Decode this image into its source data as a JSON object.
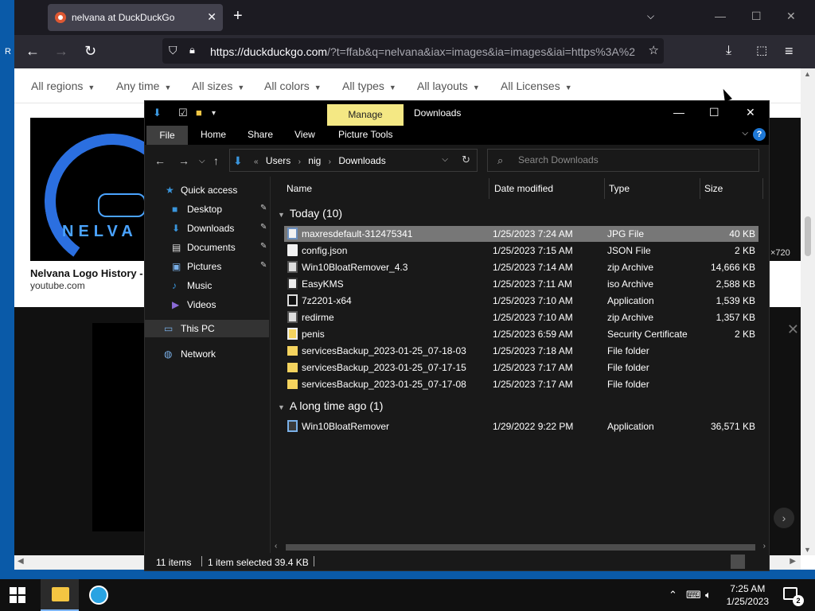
{
  "browser": {
    "tab_title": "nelvana at DuckDuckGo",
    "url_host": "https://duckduckgo.com",
    "url_rest": "/?t=ffab&q=nelvana&iax=images&ia=images&iai=https%3A%2",
    "filters": [
      "All regions",
      "Any time",
      "All sizes",
      "All colors",
      "All types",
      "All layouts",
      "All Licenses"
    ],
    "result_title": "Nelvana Logo History - Y",
    "result_source": "youtube.com",
    "logo_text": "NELVA",
    "right_img_label": "×720"
  },
  "explorer": {
    "window_title": "Downloads",
    "manage_tab": "Manage",
    "ribbon_tabs": [
      "File",
      "Home",
      "Share",
      "View",
      "Picture Tools"
    ],
    "breadcrumb": [
      "Users",
      "nig",
      "Downloads"
    ],
    "search_placeholder": "Search Downloads",
    "nav": {
      "quick_access": "Quick access",
      "desktop": "Desktop",
      "downloads": "Downloads",
      "documents": "Documents",
      "pictures": "Pictures",
      "music": "Music",
      "videos": "Videos",
      "this_pc": "This PC",
      "network": "Network"
    },
    "columns": {
      "name": "Name",
      "date": "Date modified",
      "type": "Type",
      "size": "Size"
    },
    "group_today": "Today (10)",
    "group_long_ago": "A long time ago (1)",
    "files_today": [
      {
        "name": "maxresdefault-312475341",
        "date": "1/25/2023 7:24 AM",
        "type": "JPG File",
        "size": "40 KB",
        "icon": "img"
      },
      {
        "name": "config.json",
        "date": "1/25/2023 7:15 AM",
        "type": "JSON File",
        "size": "2 KB",
        "icon": "file"
      },
      {
        "name": "Win10BloatRemover_4.3",
        "date": "1/25/2023 7:14 AM",
        "type": "zip Archive",
        "size": "14,666 KB",
        "icon": "zip"
      },
      {
        "name": "EasyKMS",
        "date": "1/25/2023 7:11 AM",
        "type": "iso Archive",
        "size": "2,588 KB",
        "icon": "iso"
      },
      {
        "name": "7z2201-x64",
        "date": "1/25/2023 7:10 AM",
        "type": "Application",
        "size": "1,539 KB",
        "icon": "app7z"
      },
      {
        "name": "redirme",
        "date": "1/25/2023 7:10 AM",
        "type": "zip Archive",
        "size": "1,357 KB",
        "icon": "zip"
      },
      {
        "name": "penis",
        "date": "1/25/2023 6:59 AM",
        "type": "Security Certificate",
        "size": "2 KB",
        "icon": "cert"
      },
      {
        "name": "servicesBackup_2023-01-25_07-18-03",
        "date": "1/25/2023 7:18 AM",
        "type": "File folder",
        "size": "",
        "icon": "folder"
      },
      {
        "name": "servicesBackup_2023-01-25_07-17-15",
        "date": "1/25/2023 7:17 AM",
        "type": "File folder",
        "size": "",
        "icon": "folder"
      },
      {
        "name": "servicesBackup_2023-01-25_07-17-08",
        "date": "1/25/2023 7:17 AM",
        "type": "File folder",
        "size": "",
        "icon": "folder"
      }
    ],
    "files_old": [
      {
        "name": "Win10BloatRemover",
        "date": "1/29/2022 9:22 PM",
        "type": "Application",
        "size": "36,571 KB",
        "icon": "appw"
      }
    ],
    "status_items": "11 items",
    "status_selected": "1 item selected  39.4 KB"
  },
  "taskbar": {
    "time": "7:25 AM",
    "date": "1/25/2023",
    "notification_count": "2"
  },
  "colors": {
    "accent_blue": "#3a96dd",
    "manage_yellow": "#f4e884",
    "explorer_bg": "#191919",
    "browser_bar": "#2b2a33"
  }
}
